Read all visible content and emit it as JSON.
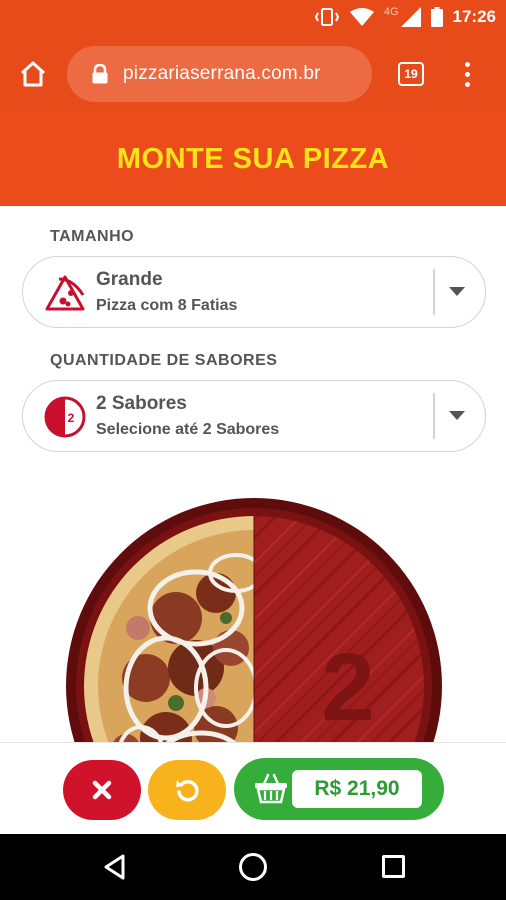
{
  "status_bar": {
    "network": "4G",
    "time": "17:26"
  },
  "browser": {
    "url": "pizzariaserrana.com.br",
    "tab_count": "19"
  },
  "page": {
    "title": "MONTE SUA PIZZA"
  },
  "size_section": {
    "label": "TAMANHO",
    "selected_title": "Grande",
    "selected_subtitle": "Pizza com 8 Fatias",
    "icon": "pizza-slice-icon"
  },
  "flavors_section": {
    "label": "QUANTIDADE DE SABORES",
    "selected_title": "2 Sabores",
    "selected_subtitle": "Selecione até 2 Sabores",
    "icon_badge": "2"
  },
  "pizza_preview": {
    "empty_slot_number": "2",
    "colors": {
      "board": "#7a1212",
      "wood": "#a11e1e",
      "crust": "#e9c98a"
    }
  },
  "actions": {
    "cancel_icon": "close-icon",
    "reset_icon": "reset-icon",
    "cart_icon": "basket-icon",
    "price": "R$ 21,90"
  },
  "colors": {
    "primary": "#e84b1a",
    "title_yellow": "#ffe11c",
    "cancel_red": "#d0122b",
    "reset_yellow": "#f7b21c",
    "cart_green": "#34ad3a"
  }
}
